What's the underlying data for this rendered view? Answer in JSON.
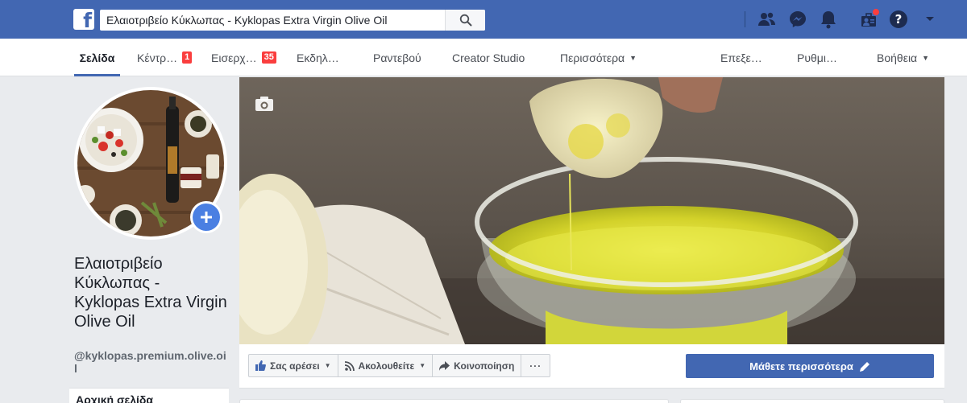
{
  "topbar": {
    "logo": "facebook-f-logo",
    "search_value": "Ελαιοτριβείο Κύκλωπας - Kyklopas Extra Virgin Olive Oil",
    "icons": [
      "search-icon",
      "friends-icon",
      "messenger-icon",
      "notifications-bell-icon",
      "page-admin-icon",
      "help-icon",
      "caret-down-icon"
    ]
  },
  "tabs": {
    "page": "Σελίδα",
    "inbox_center": "Κέντρ…",
    "inbox_center_badge": "1",
    "incoming": "Εισερχ…",
    "incoming_badge": "35",
    "events": "Εκδηλ…",
    "appointments": "Ραντεβού",
    "creator_studio": "Creator Studio",
    "more": "Περισσότερα",
    "edit": "Επεξε…",
    "settings": "Ρυθμι…",
    "help": "Βοήθεια"
  },
  "page": {
    "name": "Ελαιοτριβείο Κύκλωπας - Kyklopas Extra Virgin Olive Oil",
    "handle": "@kyklopas.premium.olive.oil",
    "left_nav_first": "Αρχική σελίδα"
  },
  "actions": {
    "like": "Σας αρέσει",
    "follow": "Ακολουθείτε",
    "share": "Κοινοποίηση",
    "more": "···",
    "learn_more": "Μάθετε περισσότερα"
  },
  "colors": {
    "brand_blue": "#4267b2",
    "badge_red": "#fa3e3e",
    "background": "#e9ebee"
  }
}
